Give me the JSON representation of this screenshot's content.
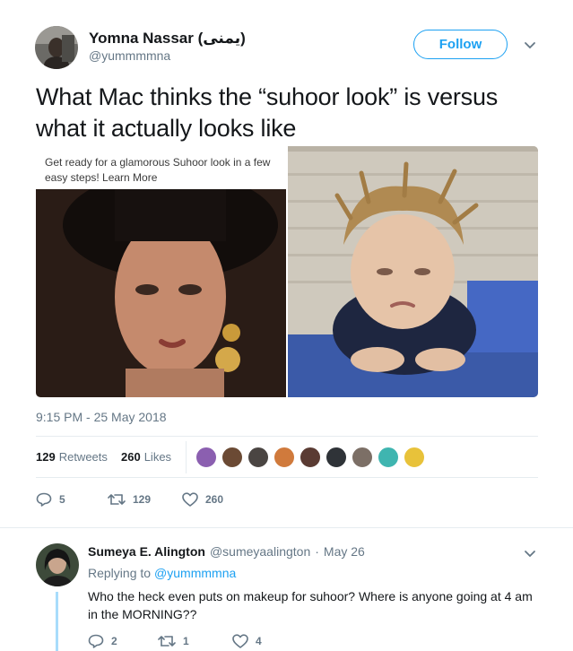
{
  "tweet": {
    "author_name": "Yomna Nassar (يمنى)",
    "author_handle": "@yummmmna",
    "follow_label": "Follow",
    "text": "What Mac thinks the “suhoor look” is versus what it actually looks like",
    "image_caption": "Get ready for a glamorous Suhoor look in a few easy steps! Learn More",
    "timestamp": "9:15 PM - 25 May 2018",
    "retweets_count": "129",
    "retweets_label": "Retweets",
    "likes_count": "260",
    "likes_label": "Likes",
    "actions": {
      "replies": "5",
      "retweets": "129",
      "likes": "260"
    }
  },
  "reply": {
    "author_name": "Sumeya E. Alington",
    "author_handle": "@sumeyaalington",
    "separator": "·",
    "date": "May 26",
    "replying_to_label": "Replying to",
    "replying_to_handle": "@yummmmna",
    "text": "Who the heck even puts on makeup for suhoor? Where is anyone going at 4 am in the MORNING??",
    "actions": {
      "replies": "2",
      "retweets": "1",
      "likes": "4"
    }
  },
  "colors": {
    "accent": "#1da1f2",
    "muted": "#657786",
    "thread_line": "#a8dcfb"
  },
  "icons": [
    "chevron-down-icon",
    "reply-icon",
    "retweet-icon",
    "like-icon"
  ]
}
